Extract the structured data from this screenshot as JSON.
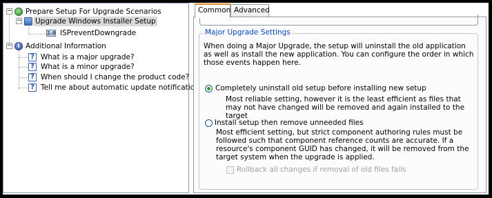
{
  "tree": {
    "items": [
      {
        "label": "Prepare Setup For Upgrade Scenarios",
        "icon": "setup-globe-icon",
        "expander": "−"
      },
      {
        "label": "Upgrade Windows Installer Setup",
        "icon": "installer-upgrade-icon",
        "expander": "−"
      },
      {
        "label": "ISPreventDowngrade",
        "icon": "version-icon",
        "icon_text": "2.0"
      },
      {
        "label": "Additional Information",
        "icon": "info-icon",
        "expander": "−"
      },
      {
        "label": "What is a major upgrade?",
        "icon": "help-icon"
      },
      {
        "label": "What is a minor upgrade?",
        "icon": "help-icon"
      },
      {
        "label": "When should I change the product code?",
        "icon": "help-icon"
      },
      {
        "label": "Tell me about automatic update notification.",
        "icon": "help-icon"
      }
    ]
  },
  "tabs": [
    {
      "label": "Common",
      "active": true
    },
    {
      "label": "Advanced",
      "active": false
    }
  ],
  "group": {
    "legend": "Major Upgrade Settings",
    "description": "When doing a Major Upgrade, the setup will uninstall the old application as well as install the new application.  You can configure the order in which those events happen here.",
    "option1": {
      "label": "Completely uninstall old setup before installing new setup",
      "selected": true,
      "description": "Most reliable setting, however it is the least efficient as files that may not have changed will be removed and again installed to the target"
    },
    "option2": {
      "label": "Install setup then remove unneeded files",
      "selected": false,
      "description": "Most efficient setting, but strict component authoring rules must be followed such that component reference counts are accurate. If a resource's component GUID has changed, it will be removed from the target system when the upgrade is applied."
    },
    "checkbox": {
      "label": "Rollback all changes if removal of old files fails",
      "checked": false,
      "enabled": false
    }
  },
  "colors": {
    "tab_accent": "#e68b2c",
    "legend_text": "#0046d5",
    "selection_bg": "#d9d9d9"
  }
}
